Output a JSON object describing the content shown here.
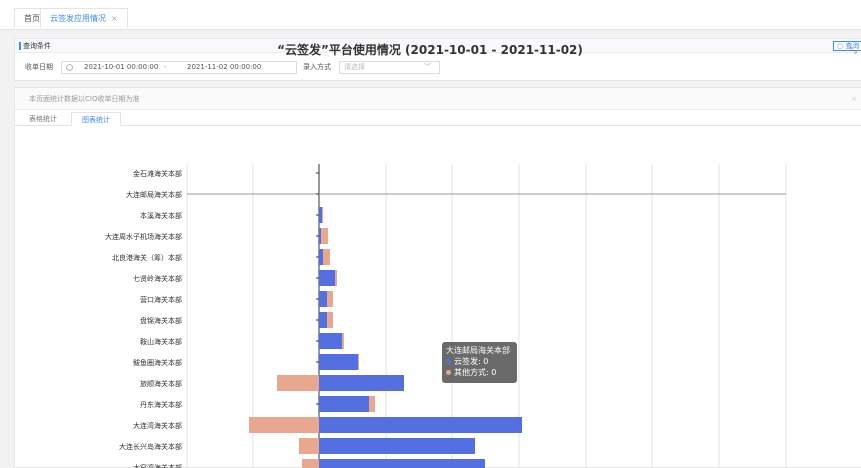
{
  "tabs": [
    {
      "label": "首页"
    },
    {
      "label": "云签发应用情况",
      "close": "×"
    }
  ],
  "query": {
    "title": "查询条件",
    "button": "查询",
    "date_label": "收单日期",
    "date_start": "2021-10-01 00:00:00",
    "date_sep": "-",
    "date_end": "2021-11-02 00:00:00",
    "entry_label": "录入方式",
    "entry_placeholder": "请选择"
  },
  "results": {
    "note": "本页面统计数据以CIQ收单日期为准",
    "tabs": [
      "表格统计",
      "图表统计"
    ],
    "active_tab": "图表统计"
  },
  "tooltip": {
    "title": "大连邮局海关本部",
    "line1": "云签发: 0",
    "line2": "其他方式: 0"
  },
  "colors": {
    "cloud": "#5470e0",
    "other": "#e8a890",
    "accent": "#3a8ee6"
  },
  "chart_data": {
    "type": "bar",
    "orientation": "horizontal-diverging",
    "title": "“云签发”平台使用情况 (2021-10-01 - 2021-11-02)",
    "categories": [
      "金石滩海关本部",
      "大连邮局海关本部",
      "本溪海关本部",
      "大连周水子机场海关本部",
      "北良港海关（筹）本部",
      "七贤岭海关本部",
      "营口海关本部",
      "盘锦海关本部",
      "鞍山海关本部",
      "鲅鱼圈海关本部",
      "旅顺海关本部",
      "丹东海关本部",
      "大连湾海关本部",
      "大连长兴岛海关本部",
      "大窑湾海关本部"
    ],
    "series": [
      {
        "name": "云签发",
        "values": [
          0,
          0,
          3,
          2,
          4,
          16,
          8,
          8,
          23,
          39,
          85,
          50,
          203,
          156,
          166
        ]
      },
      {
        "name": "其他方式",
        "values": [
          0,
          0,
          1,
          7,
          7,
          2,
          6,
          6,
          2,
          1,
          42,
          6,
          70,
          20,
          17
        ]
      }
    ],
    "grid": true
  }
}
